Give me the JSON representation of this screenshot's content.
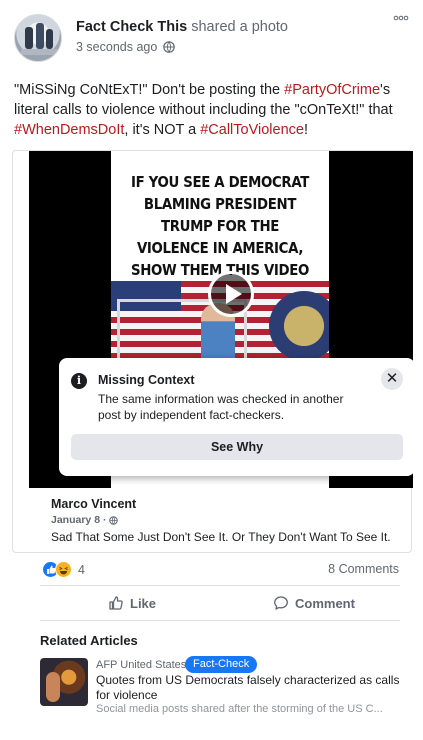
{
  "post": {
    "author": "Fact Check This",
    "action": "shared a photo",
    "timestamp": "3 seconds ago",
    "privacy_icon": "globe-icon",
    "text_parts": [
      {
        "text": "\"MiSSiNg CoNtExT!\" Don't be posting the ",
        "tag": false
      },
      {
        "text": "#PartyOfCrime",
        "tag": true
      },
      {
        "text": "'s literal calls to violence without including the \"cOnTeXt!\" that ",
        "tag": false
      },
      {
        "text": "#WhenDemsDoIt",
        "tag": true
      },
      {
        "text": ", it's NOT a ",
        "tag": false
      },
      {
        "text": "#CallToViolence",
        "tag": true
      },
      {
        "text": "!",
        "tag": false
      }
    ]
  },
  "video": {
    "headline": "IF YOU SEE A DEMOCRAT BLAMING PRESIDENT TRUMP FOR THE VIOLENCE IN AMERICA, SHOW THEM THIS VIDEO"
  },
  "fact_check": {
    "title": "Missing Context",
    "body": "The same information was checked in another post by independent fact-checkers.",
    "button": "See Why",
    "close": "✕"
  },
  "comment": {
    "author": "Marco Vincent",
    "date": "January 8 ·",
    "text": "Sad That Some Just Don't See It. Or They Don't Want To See It."
  },
  "engagement": {
    "reaction_count": "4",
    "comments": "8 Comments",
    "like_label": "Like",
    "comment_label": "Comment"
  },
  "related": {
    "heading": "Related Articles",
    "source": "AFP United States",
    "badge": "Fact-Check",
    "headline": "Quotes from US Democrats falsely characterized as calls for violence",
    "description": "Social media posts shared after the storming of the US C..."
  },
  "colors": {
    "hashtag": "#b71c1c",
    "accent": "#1877f2",
    "button_bg": "#e4e6eb"
  }
}
